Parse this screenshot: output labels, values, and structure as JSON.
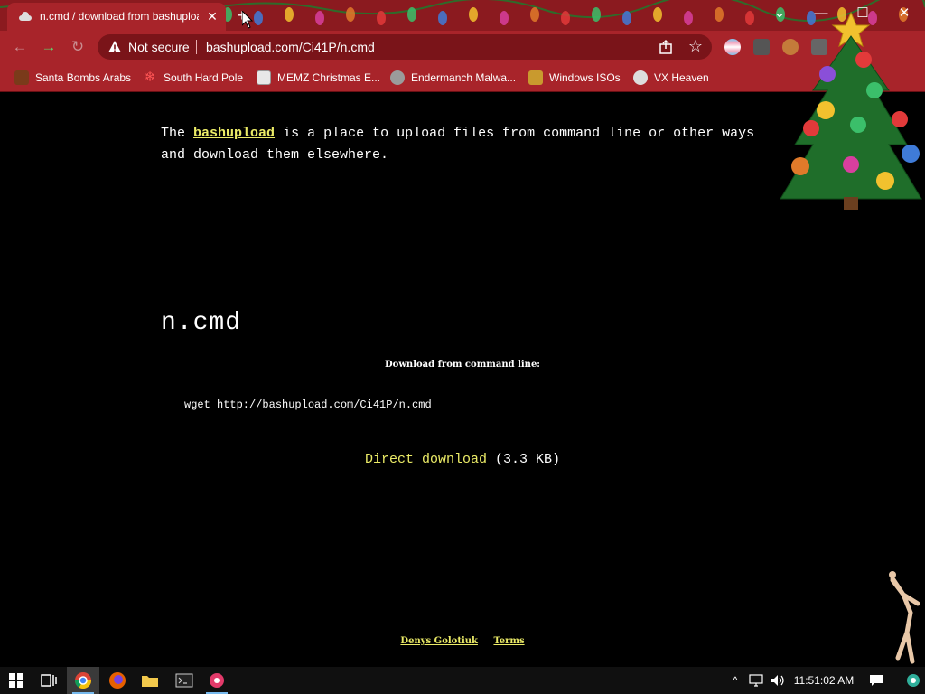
{
  "browser": {
    "tab_title": "n.cmd / download from bashupload",
    "tab_close": "✕",
    "new_tab": "+",
    "not_secure": "Not secure",
    "url": "bashupload.com/Ci41P/n.cmd",
    "window_buttons": {
      "tab_search": "⌄",
      "minimize": "—",
      "maximize": "☐",
      "close": "✕"
    },
    "accent_color": "#8b1a1f"
  },
  "bookmarks": [
    {
      "label": "Santa Bombs Arabs",
      "icon": "santa-icon"
    },
    {
      "label": "South Hard Pole",
      "icon": "snowflake-icon"
    },
    {
      "label": "MEMZ Christmas E...",
      "icon": "memz-icon"
    },
    {
      "label": "Endermanch Malwa...",
      "icon": "endermanch-icon"
    },
    {
      "label": "Windows ISOs",
      "icon": "trophy-icon"
    },
    {
      "label": "VX Heaven",
      "icon": "vx-icon"
    }
  ],
  "page": {
    "intro_prefix": "The",
    "intro_link": "bashupload",
    "intro_suffix": "is a place to upload files from command line or other ways and download them elsewhere.",
    "filename": "n.cmd",
    "download_heading": "Download from command line:",
    "command": "wget http://bashupload.com/Ci41P/n.cmd",
    "direct_link": "Direct download",
    "file_size": "(3.3 KB)",
    "footer_author": "Denys Golotiuk",
    "footer_terms": "Terms",
    "link_color": "#ecec67"
  },
  "taskbar": {
    "clock": "11:51:02 AM"
  }
}
